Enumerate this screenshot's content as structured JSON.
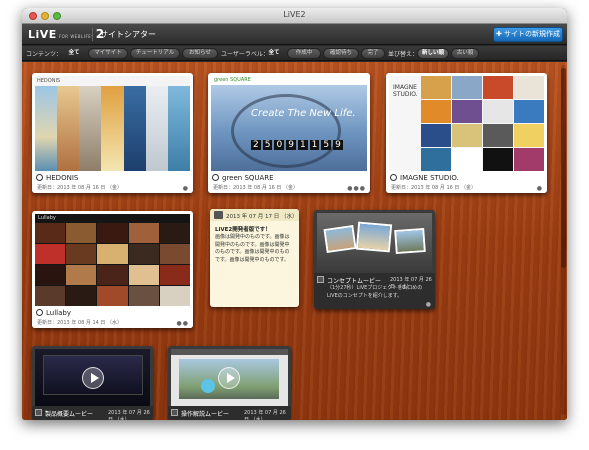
{
  "window": {
    "title": "LiVE2"
  },
  "header": {
    "logo_main": "LiVE",
    "logo_sub": "FOR WEBLIFE*",
    "logo_ver": "2",
    "page_title": "サイトシアター",
    "new_site_button": "サイトの新規作成",
    "new_site_icon": "plus-sparkle-icon"
  },
  "filters": {
    "content_label": "コンテンツ：",
    "content_chips": [
      "全て",
      "マイサイト",
      "チュートリアル",
      "お知らせ"
    ],
    "content_selected": "全て",
    "user_label": "ユーザーラベル：",
    "user_chips": [
      "全て",
      "作成中",
      "確認待ち",
      "完了"
    ],
    "user_selected": "全て",
    "sort_label": "並び替え：",
    "sort_chips": [
      "新しい順",
      "古い順"
    ],
    "sort_selected": "新しい順"
  },
  "sites": [
    {
      "name": "HEDONIS",
      "date": "更新日：2013 年 08 月 16 日 （金）"
    },
    {
      "name": "green SQUARE",
      "date": "更新日：2013 年 08 月 16 日 （金）",
      "thumb_text": "Create The New Life.",
      "counter": [
        "2",
        "5",
        "0",
        "9",
        "1",
        "1",
        "5",
        "9"
      ]
    },
    {
      "name": "IMAGNE STUDIO.",
      "date": "更新日：2013 年 08 月 16 日 （金）",
      "thumb_text": "IMAGNE STUDIO."
    },
    {
      "name": "Lullaby",
      "date": "更新日：2013 年 08 月 14 日 （水）"
    }
  ],
  "note": {
    "date": "2013 年 07 月 17 日 （水）",
    "title": "LiVE2開発者版です！",
    "body": "画像は開発中のものです。画像は開発中のものです。画像は開発中のものです。画像は開発中のものです。画像は開発中のものです。"
  },
  "videos": [
    {
      "name": "コンセプトムービー",
      "date": "2013 年 07 月 26 日 （水）",
      "desc1": "（1分27秒）LiVEプロジェクトを山口めの",
      "desc2": "LiVEのコンセプトを紹介します。"
    },
    {
      "name": "製品概要ムービー",
      "date": "2013 年 07 月 26 日 （水）"
    },
    {
      "name": "操作解説ムービー",
      "date": "2013 年 07 月 26 日 （水）"
    }
  ],
  "colors": {
    "accent": "#2a85d8",
    "wood": "#a8471a"
  }
}
